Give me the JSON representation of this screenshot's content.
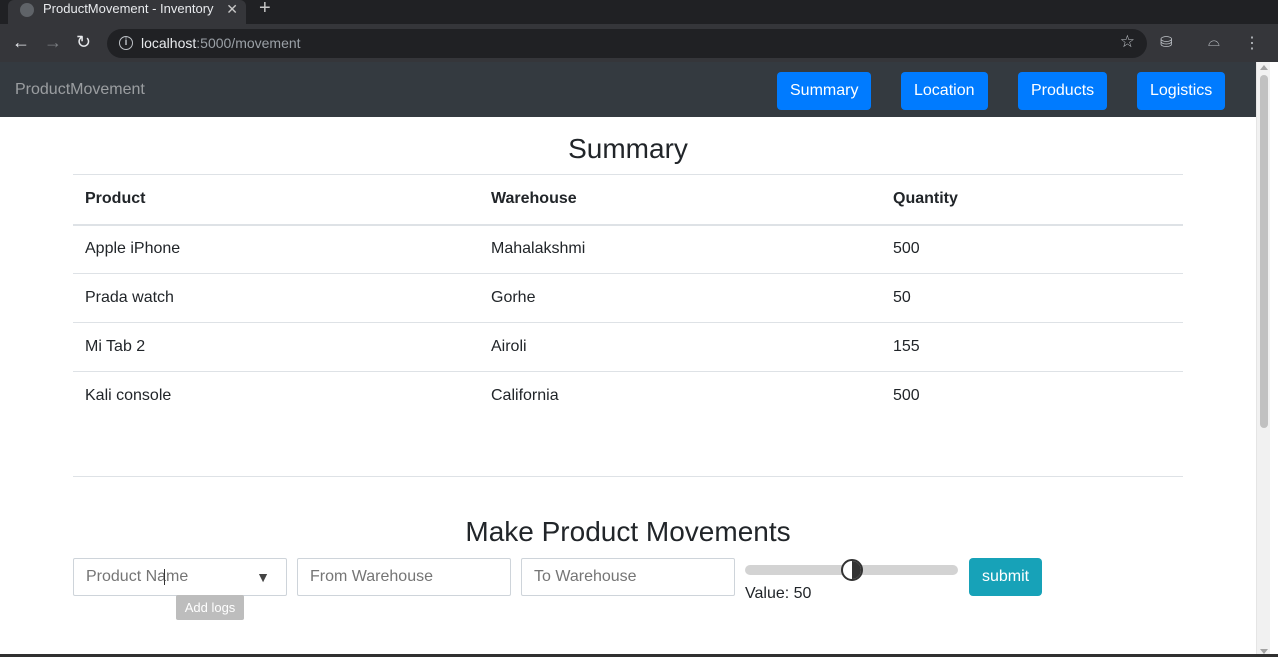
{
  "browser": {
    "tab_title": "ProductMovement - Inventory",
    "url_host": "localhost",
    "url_path": ":5000/movement"
  },
  "nav": {
    "brand": "ProductMovement",
    "links": [
      "Summary",
      "Location",
      "Products",
      "Logistics"
    ]
  },
  "summary": {
    "title": "Summary",
    "columns": [
      "Product",
      "Warehouse",
      "Quantity"
    ],
    "rows": [
      [
        "Apple iPhone",
        "Mahalakshmi",
        "500"
      ],
      [
        "Prada watch",
        "Gorhe",
        "50"
      ],
      [
        "Mi Tab 2",
        "Airoli",
        "155"
      ],
      [
        "Kali console",
        "California",
        "500"
      ]
    ]
  },
  "movement": {
    "title": "Make Product Movements",
    "product_placeholder": "Product Name",
    "from_placeholder": "From Warehouse",
    "to_placeholder": "To Warehouse",
    "slider_value": 50,
    "value_label": "Value: 50",
    "submit_label": "submit",
    "tooltip": "Add logs"
  },
  "colors": {
    "primary": "#007bff",
    "info": "#17a2b8",
    "navbar": "#343a40"
  }
}
